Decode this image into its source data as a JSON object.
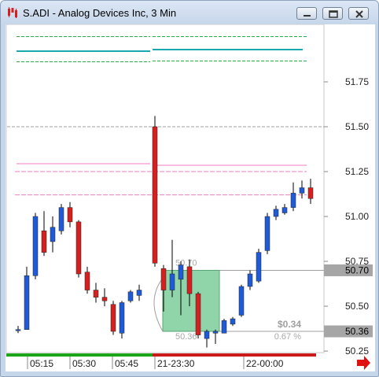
{
  "window": {
    "title": "S.ADI - Analog Devices Inc, 3 Min",
    "buttons": [
      "minimize",
      "maximize",
      "close"
    ]
  },
  "icons": {
    "app": "candlestick-app-icon",
    "nav": "red-arrow-right-icon"
  },
  "price_labels": {
    "top": "50.70",
    "bottom": "50.36"
  },
  "trade": {
    "profit": "$0.34",
    "percent": "0.67 %",
    "entry_label": "50.70",
    "exit_label": "50.36"
  },
  "colors": {
    "bull": "#1f5bd6",
    "bear": "#d61f1f",
    "trade_box": "#7dcc9a",
    "teal_line": "#1aa8b0"
  },
  "chart_data": {
    "type": "candlestick",
    "title": "",
    "y_ticks": [
      "51.75",
      "51.50",
      "51.25",
      "51.00",
      "50.75",
      "50.50",
      "50.25"
    ],
    "ylim": [
      50.18,
      52.05
    ],
    "x_ticks": [
      "05:15",
      "05:30",
      "05:45",
      "21-23:30",
      "22-00:00"
    ],
    "session_break": "21-23:30",
    "candles": [
      {
        "o": 50.37,
        "h": 50.39,
        "l": 50.35,
        "c": 50.37
      },
      {
        "o": 50.37,
        "h": 50.72,
        "l": 50.37,
        "c": 50.67
      },
      {
        "o": 50.67,
        "h": 51.02,
        "l": 50.65,
        "c": 51.0
      },
      {
        "o": 50.92,
        "h": 51.03,
        "l": 50.78,
        "c": 50.8
      },
      {
        "o": 50.86,
        "h": 51.0,
        "l": 50.8,
        "c": 50.94
      },
      {
        "o": 50.92,
        "h": 51.07,
        "l": 50.9,
        "c": 51.05
      },
      {
        "o": 51.05,
        "h": 51.08,
        "l": 50.94,
        "c": 50.97
      },
      {
        "o": 50.97,
        "h": 50.98,
        "l": 50.66,
        "c": 50.68
      },
      {
        "o": 50.69,
        "h": 50.72,
        "l": 50.57,
        "c": 50.59
      },
      {
        "o": 50.59,
        "h": 50.63,
        "l": 50.52,
        "c": 50.55
      },
      {
        "o": 50.55,
        "h": 50.6,
        "l": 50.5,
        "c": 50.53
      },
      {
        "o": 50.51,
        "h": 50.53,
        "l": 50.34,
        "c": 50.36
      },
      {
        "o": 50.35,
        "h": 50.53,
        "l": 50.32,
        "c": 50.52
      },
      {
        "o": 50.53,
        "h": 50.59,
        "l": 50.52,
        "c": 50.58
      },
      {
        "o": 50.56,
        "h": 50.62,
        "l": 50.53,
        "c": 50.59
      },
      {
        "o": 51.5,
        "h": 51.56,
        "l": 50.72,
        "c": 50.74
      },
      {
        "o": 50.71,
        "h": 50.73,
        "l": 50.47,
        "c": 50.59
      },
      {
        "o": 50.59,
        "h": 50.87,
        "l": 50.55,
        "c": 50.68
      },
      {
        "o": 50.65,
        "h": 50.75,
        "l": 50.45,
        "c": 50.73
      },
      {
        "o": 50.72,
        "h": 50.76,
        "l": 50.5,
        "c": 50.57
      },
      {
        "o": 50.57,
        "h": 50.58,
        "l": 50.32,
        "c": 50.34
      },
      {
        "o": 50.32,
        "h": 50.37,
        "l": 50.27,
        "c": 50.36
      },
      {
        "o": 50.35,
        "h": 50.37,
        "l": 50.29,
        "c": 50.36
      },
      {
        "o": 50.35,
        "h": 50.43,
        "l": 50.35,
        "c": 50.42
      },
      {
        "o": 50.4,
        "h": 50.44,
        "l": 50.39,
        "c": 50.43
      },
      {
        "o": 50.45,
        "h": 50.62,
        "l": 50.44,
        "c": 50.61
      },
      {
        "o": 50.61,
        "h": 50.7,
        "l": 50.59,
        "c": 50.68
      },
      {
        "o": 50.64,
        "h": 50.82,
        "l": 50.63,
        "c": 50.8
      },
      {
        "o": 50.81,
        "h": 51.02,
        "l": 50.79,
        "c": 51.0
      },
      {
        "o": 51.0,
        "h": 51.06,
        "l": 50.98,
        "c": 51.04
      },
      {
        "o": 51.02,
        "h": 51.07,
        "l": 51.01,
        "c": 51.05
      },
      {
        "o": 51.05,
        "h": 51.19,
        "l": 51.03,
        "c": 51.13
      },
      {
        "o": 51.13,
        "h": 51.2,
        "l": 51.1,
        "c": 51.16
      },
      {
        "o": 51.16,
        "h": 51.21,
        "l": 51.07,
        "c": 51.1
      }
    ]
  }
}
